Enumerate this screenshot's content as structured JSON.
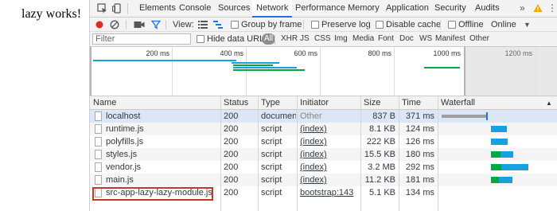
{
  "page": {
    "text": "lazy works!"
  },
  "devtools": {
    "tabs": [
      "Elements",
      "Console",
      "Sources",
      "Network",
      "Performance",
      "Memory",
      "Application",
      "Security",
      "Audits"
    ],
    "active_tab": "Network",
    "more_tabs": "»",
    "toolbar": {
      "view_label": "View:",
      "group_by_frame": "Group by frame",
      "preserve_log": "Preserve log",
      "disable_cache": "Disable cache",
      "offline": "Offline",
      "throttle_value": "Online"
    },
    "filter": {
      "placeholder": "Filter",
      "hide_data_urls": "Hide data URLs",
      "types": [
        "All",
        "XHR",
        "JS",
        "CSS",
        "Img",
        "Media",
        "Font",
        "Doc",
        "WS",
        "Manifest",
        "Other"
      ],
      "active_type": "All"
    },
    "overview": {
      "ticks": [
        "200 ms",
        "400 ms",
        "600 ms",
        "800 ms",
        "1000 ms",
        "1200 ms"
      ]
    },
    "table": {
      "headers": {
        "name": "Name",
        "status": "Status",
        "type": "Type",
        "initiator": "Initiator",
        "size": "Size",
        "time": "Time",
        "waterfall": "Waterfall"
      },
      "rows": [
        {
          "name": "localhost",
          "status": "200",
          "type": "document",
          "initiator": "Other",
          "size": "837 B",
          "time": "371 ms"
        },
        {
          "name": "runtime.js",
          "status": "200",
          "type": "script",
          "initiator": "(index)",
          "size": "8.1 KB",
          "time": "124 ms"
        },
        {
          "name": "polyfills.js",
          "status": "200",
          "type": "script",
          "initiator": "(index)",
          "size": "222 KB",
          "time": "126 ms"
        },
        {
          "name": "styles.js",
          "status": "200",
          "type": "script",
          "initiator": "(index)",
          "size": "15.5 KB",
          "time": "180 ms"
        },
        {
          "name": "vendor.js",
          "status": "200",
          "type": "script",
          "initiator": "(index)",
          "size": "3.2 MB",
          "time": "292 ms"
        },
        {
          "name": "main.js",
          "status": "200",
          "type": "script",
          "initiator": "(index)",
          "size": "11.2 KB",
          "time": "181 ms"
        },
        {
          "name": "src-app-lazy-lazy-module.js",
          "status": "200",
          "type": "script",
          "initiator": "bootstrap:143",
          "size": "5.1 KB",
          "time": "134 ms"
        }
      ]
    },
    "colors": {
      "accent": "#1a73e8",
      "record": "#d93025",
      "waiting": "#00a846",
      "download": "#1a9fe0",
      "highlight": "#c0392b"
    }
  }
}
